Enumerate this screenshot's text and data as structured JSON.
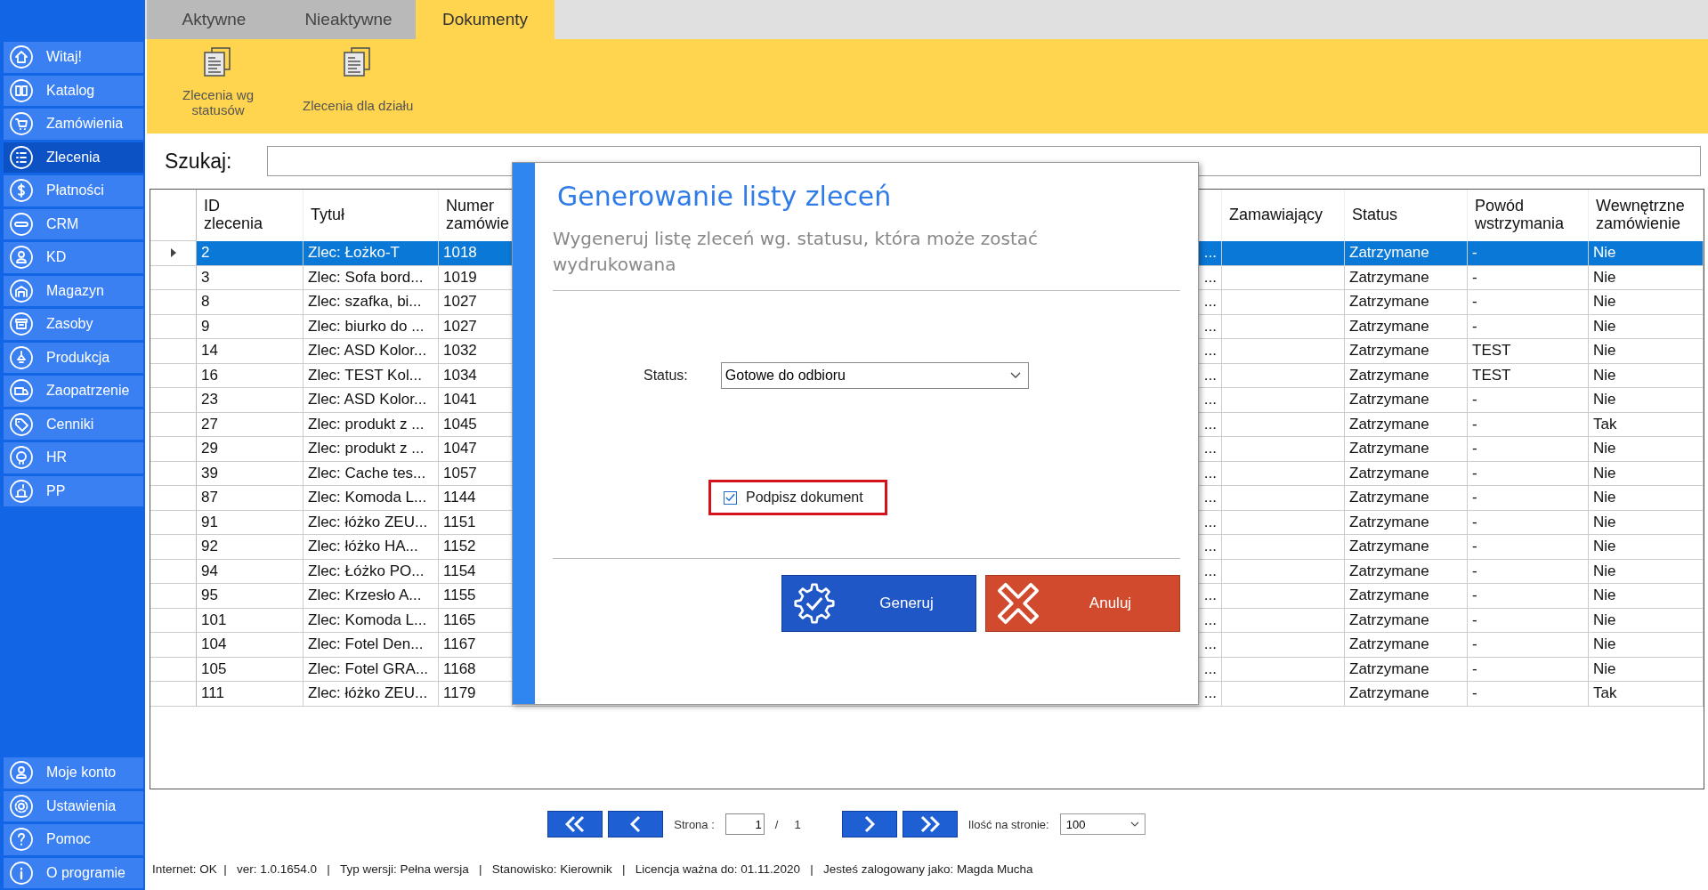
{
  "sidebar": {
    "items": [
      {
        "label": "Witaj!",
        "selected": false
      },
      {
        "label": "Katalog",
        "selected": false
      },
      {
        "label": "Zamówienia",
        "selected": false
      },
      {
        "label": "Zlecenia",
        "selected": true
      },
      {
        "label": "Płatności",
        "selected": false
      },
      {
        "label": "CRM",
        "selected": false
      },
      {
        "label": "KD",
        "selected": false
      },
      {
        "label": "Magazyn",
        "selected": false
      },
      {
        "label": "Zasoby",
        "selected": false
      },
      {
        "label": "Produkcja",
        "selected": false
      },
      {
        "label": "Zaopatrzenie",
        "selected": false
      },
      {
        "label": "Cenniki",
        "selected": false
      },
      {
        "label": "HR",
        "selected": false
      },
      {
        "label": "PP",
        "selected": false
      }
    ],
    "bottom_items": [
      {
        "label": "Moje konto",
        "selected": false
      },
      {
        "label": "Ustawienia",
        "selected": false
      },
      {
        "label": "Pomoc",
        "selected": false
      },
      {
        "label": "O programie",
        "selected": false
      }
    ]
  },
  "tabs": [
    {
      "label": "Aktywne",
      "selected": false
    },
    {
      "label": "Nieaktywne",
      "selected": false
    },
    {
      "label": "Dokumenty",
      "selected": true
    }
  ],
  "ribbon": {
    "buttons": [
      {
        "label": "Zlecenia wg statusów"
      },
      {
        "label": "Zlecenia dla działu"
      }
    ]
  },
  "search": {
    "label": "Szukaj:"
  },
  "table": {
    "columns": [
      {
        "label": "ID zlecenia"
      },
      {
        "label": "Tytuł"
      },
      {
        "label": "Numer zamówie"
      },
      {
        "label": "Zamawiający"
      },
      {
        "label": "Status"
      },
      {
        "label": "Powód wstrzymania"
      },
      {
        "label": "Wewnętrzne zamówienie"
      }
    ],
    "rows": [
      {
        "selected": true,
        "id": "2",
        "title": "Zlec: Łożko-T",
        "order_number": "1018",
        "column_4": "...",
        "status": "Zatrzymane",
        "hold_reason": "-",
        "internal_order": "Nie"
      },
      {
        "selected": false,
        "id": "3",
        "title": "Zlec: Sofa bord...",
        "order_number": "1019",
        "column_4": "...",
        "status": "Zatrzymane",
        "hold_reason": "-",
        "internal_order": "Nie"
      },
      {
        "selected": false,
        "id": "8",
        "title": "Zlec: szafka, bi...",
        "order_number": "1027",
        "column_4": "...",
        "status": "Zatrzymane",
        "hold_reason": "-",
        "internal_order": "Nie"
      },
      {
        "selected": false,
        "id": "9",
        "title": "Zlec: biurko do ...",
        "order_number": "1027",
        "column_4": "...",
        "status": "Zatrzymane",
        "hold_reason": "-",
        "internal_order": "Nie"
      },
      {
        "selected": false,
        "id": "14",
        "title": "Zlec: ASD Kolor...",
        "order_number": "1032",
        "column_4": "...",
        "status": "Zatrzymane",
        "hold_reason": "TEST",
        "internal_order": "Nie"
      },
      {
        "selected": false,
        "id": "16",
        "title": "Zlec: TEST Kol...",
        "order_number": "1034",
        "column_4": "...",
        "status": "Zatrzymane",
        "hold_reason": "TEST",
        "internal_order": "Nie"
      },
      {
        "selected": false,
        "id": "23",
        "title": "Zlec: ASD Kolor...",
        "order_number": "1041",
        "column_4": "...",
        "status": "Zatrzymane",
        "hold_reason": "-",
        "internal_order": "Nie"
      },
      {
        "selected": false,
        "id": "27",
        "title": "Zlec: produkt z ...",
        "order_number": "1045",
        "column_4": "...",
        "status": "Zatrzymane",
        "hold_reason": "-",
        "internal_order": "Tak"
      },
      {
        "selected": false,
        "id": "29",
        "title": "Zlec: produkt z ...",
        "order_number": "1047",
        "column_4": "...",
        "status": "Zatrzymane",
        "hold_reason": "-",
        "internal_order": "Nie"
      },
      {
        "selected": false,
        "id": "39",
        "title": "Zlec: Cache tes...",
        "order_number": "1057",
        "column_4": "...",
        "status": "Zatrzymane",
        "hold_reason": "-",
        "internal_order": "Nie"
      },
      {
        "selected": false,
        "id": "87",
        "title": "Zlec: Komoda L...",
        "order_number": "1144",
        "column_4": "...",
        "status": "Zatrzymane",
        "hold_reason": "-",
        "internal_order": "Nie"
      },
      {
        "selected": false,
        "id": "91",
        "title": "Zlec: łóżko ZEU...",
        "order_number": "1151",
        "column_4": "...",
        "status": "Zatrzymane",
        "hold_reason": "-",
        "internal_order": "Nie"
      },
      {
        "selected": false,
        "id": "92",
        "title": "Zlec: łóżko HA...",
        "order_number": "1152",
        "column_4": "...",
        "status": "Zatrzymane",
        "hold_reason": "-",
        "internal_order": "Nie"
      },
      {
        "selected": false,
        "id": "94",
        "title": "Zlec: Łóżko PO...",
        "order_number": "1154",
        "column_4": "...",
        "status": "Zatrzymane",
        "hold_reason": "-",
        "internal_order": "Nie"
      },
      {
        "selected": false,
        "id": "95",
        "title": "Zlec: Krzesło A...",
        "order_number": "1155",
        "column_4": "...",
        "status": "Zatrzymane",
        "hold_reason": "-",
        "internal_order": "Nie"
      },
      {
        "selected": false,
        "id": "101",
        "title": "Zlec: Komoda L...",
        "order_number": "1165",
        "column_4": "...",
        "status": "Zatrzymane",
        "hold_reason": "-",
        "internal_order": "Nie"
      },
      {
        "selected": false,
        "id": "104",
        "title": "Zlec: Fotel Den...",
        "order_number": "1167",
        "column_4": "...",
        "status": "Zatrzymane",
        "hold_reason": "-",
        "internal_order": "Nie"
      },
      {
        "selected": false,
        "id": "105",
        "title": "Zlec: Fotel GRA...",
        "order_number": "1168",
        "column_4": "...",
        "status": "Zatrzymane",
        "hold_reason": "-",
        "internal_order": "Nie"
      },
      {
        "selected": false,
        "id": "111",
        "title": "Zlec: łóżko ZEU...",
        "order_number": "1179",
        "column_4": "...",
        "status": "Zatrzymane",
        "hold_reason": "-",
        "internal_order": "Tak"
      }
    ]
  },
  "pagination": {
    "page_label": "Strona :",
    "page": "1",
    "separator": "/",
    "total": "1",
    "per_page_label": "Ilość na stronie:",
    "per_page": "100"
  },
  "status_bar": "Internet: OK  |   ver: 1.0.1654.0   |   Typ wersji: Pełna wersja   |   Stanowisko: Kierownik   |   Licencja ważna do: 01.11.2020   |   Jesteś zalogowany jako: Magda Mucha",
  "dialog": {
    "title": "Generowanie listy zleceń",
    "subtitle": "Wygeneruj listę zleceń wg. statusu, która może zostać wydrukowana",
    "status_label": "Status:",
    "status_value": "Gotowe do odbioru",
    "checkbox": {
      "label": "Podpisz dokument",
      "checked": true
    },
    "buttons": [
      {
        "label": "Generuj",
        "kind": "confirm"
      },
      {
        "label": "Anuluj",
        "kind": "cancel"
      }
    ]
  }
}
